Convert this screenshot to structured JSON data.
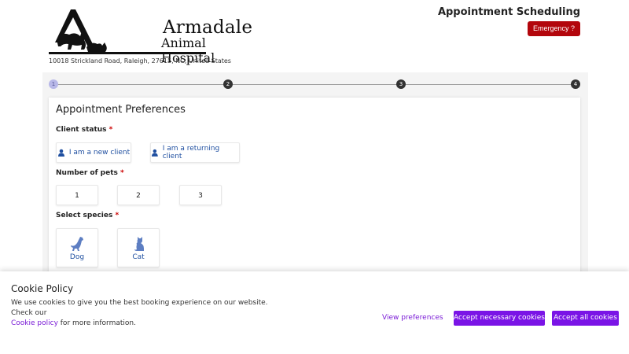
{
  "header": {
    "logo_line1": "Armadale",
    "logo_line2": "Animal Hospital",
    "address": "10018 Strickland Road, Raleigh, 27615, NC, United States",
    "app_title": "Appointment Scheduling",
    "emergency_label": "Emergency ?"
  },
  "stepper": {
    "steps": [
      "1",
      "2",
      "3",
      "4"
    ],
    "active_step": "1"
  },
  "form": {
    "title": "Appointment Preferences",
    "client_status": {
      "label": "Client status",
      "required_mark": "*",
      "options": [
        "I am a new client",
        "I am a returning client"
      ]
    },
    "pets": {
      "label": "Number of pets",
      "required_mark": "*",
      "options": [
        "1",
        "2",
        "3"
      ]
    },
    "species": {
      "label": "Select species",
      "required_mark": "*",
      "options": [
        {
          "label": "Dog",
          "icon": "dog-icon"
        },
        {
          "label": "Cat",
          "icon": "cat-icon"
        }
      ]
    }
  },
  "cookie": {
    "title": "Cookie Policy",
    "text_before": "We use cookies to give you the best booking experience on our website. Check our",
    "link": "Cookie policy",
    "text_after": " for more information.",
    "view_preferences": "View preferences",
    "accept_necessary": "Accept necessary cookies",
    "accept_all": "Accept all cookies"
  },
  "colors": {
    "emergency": "#b3060c",
    "accent_purple": "#7a14e6",
    "option_text": "#1f4fa0"
  }
}
